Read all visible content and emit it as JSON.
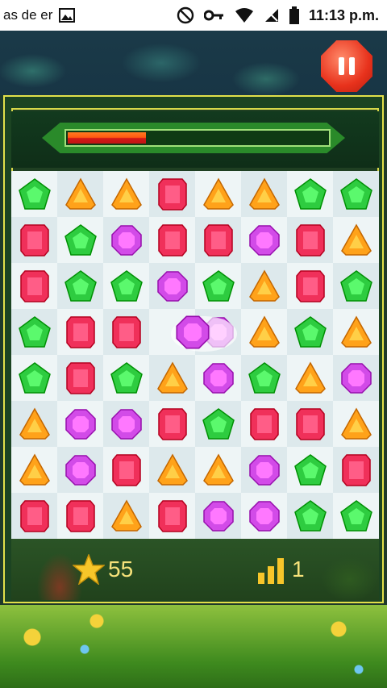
{
  "status_bar": {
    "notification_text": "as de er",
    "time": "11:13 p.m."
  },
  "progress": {
    "fraction": 0.3
  },
  "board": {
    "rows": [
      [
        "green",
        "orange",
        "orange",
        "red",
        "orange",
        "orange",
        "green",
        "green"
      ],
      [
        "red",
        "green",
        "purple",
        "red",
        "red",
        "purple",
        "red",
        "orange"
      ],
      [
        "red",
        "green",
        "green",
        "purple",
        "green",
        "orange",
        "red",
        "green"
      ],
      [
        "green",
        "red",
        "red",
        "empty",
        "purple",
        "orange",
        "green",
        "orange"
      ],
      [
        "green",
        "red",
        "green",
        "orange",
        "purple",
        "green",
        "orange",
        "purple"
      ],
      [
        "orange",
        "purple",
        "purple",
        "red",
        "green",
        "red",
        "red",
        "orange"
      ],
      [
        "orange",
        "purple",
        "red",
        "orange",
        "orange",
        "purple",
        "green",
        "red"
      ],
      [
        "red",
        "red",
        "orange",
        "red",
        "purple",
        "purple",
        "green",
        "green"
      ]
    ],
    "gem_colors": {
      "green": "#2ecc40",
      "orange": "#ffa21a",
      "red": "#f0305a",
      "purple": "#d24be8"
    }
  },
  "hud": {
    "score": "55",
    "level": "1"
  },
  "icons": {
    "pause": "pause-icon",
    "star": "star-icon",
    "level": "signal-bars-icon"
  }
}
